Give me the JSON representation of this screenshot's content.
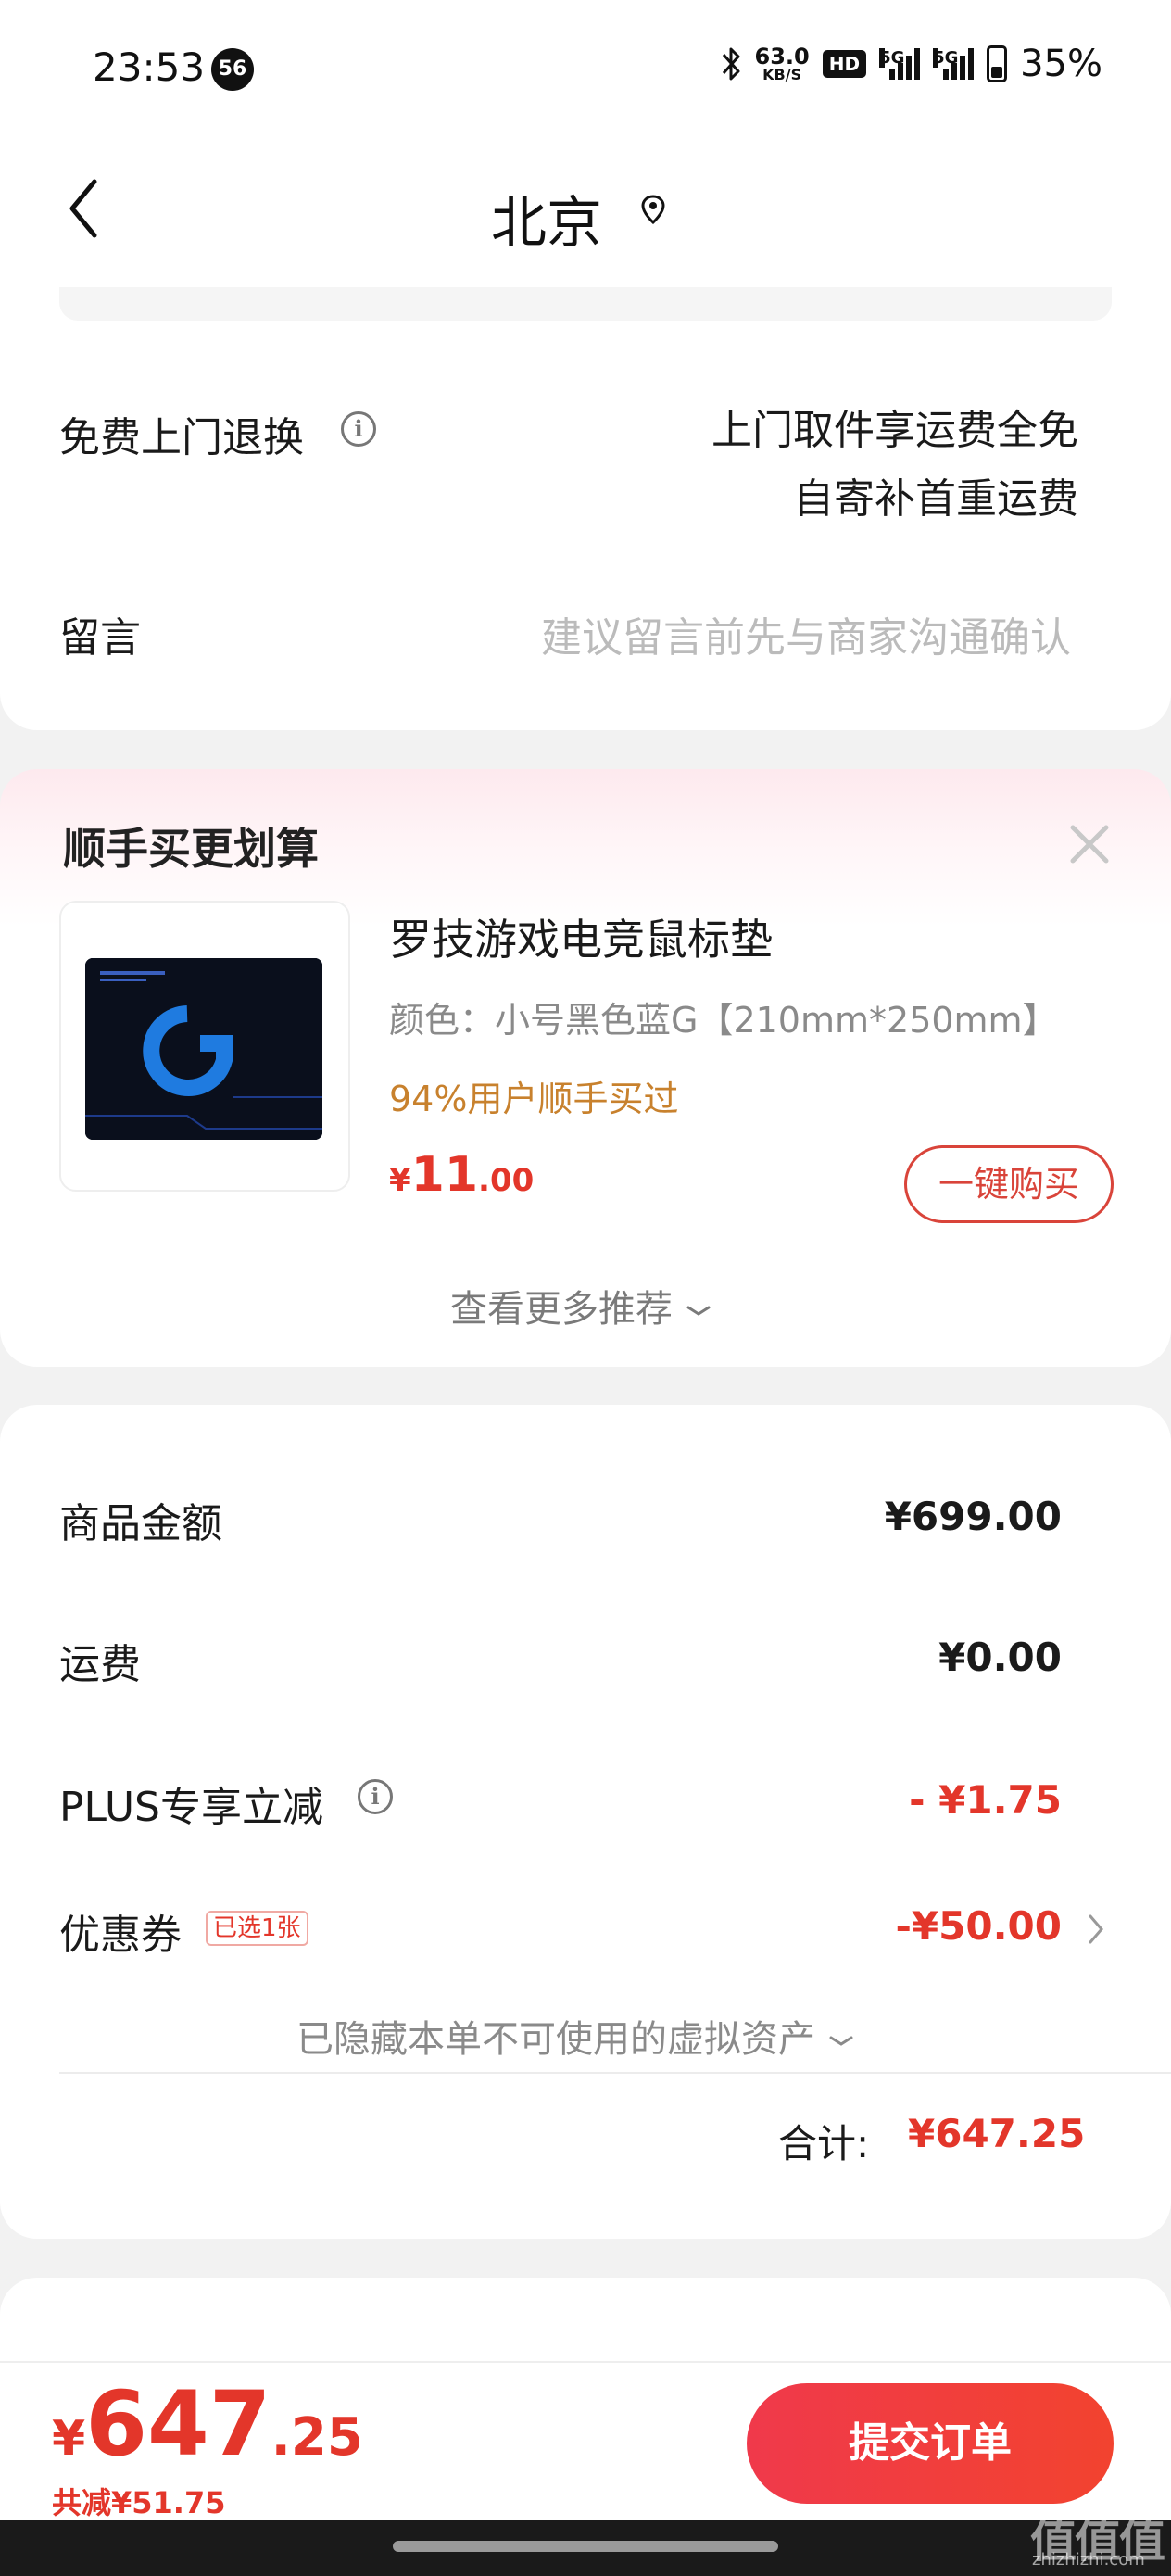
{
  "status_bar": {
    "time": "23:53",
    "notification_count": "56",
    "net_speed_value": "63.0",
    "net_speed_unit": "KB/S",
    "hd_label": "HD",
    "signal1_label": "5G",
    "signal2_label": "5G",
    "battery": "35%"
  },
  "header": {
    "title": "北京",
    "icons": [
      "back-arrow-icon",
      "location-pin-icon"
    ]
  },
  "shipping": {
    "return_label": "免费上门退换",
    "return_line1": "上门取件享运费全免",
    "return_line2": "自寄补首重运费",
    "message_label": "留言",
    "message_placeholder": "建议留言前先与商家沟通确认"
  },
  "recommend": {
    "title": "顺手买更划算",
    "product_name": "罗技游戏电竞鼠标垫",
    "product_spec": "颜色：小号黑色蓝G【210mm*250mm】",
    "social_proof": "94%用户顺手买过",
    "price_symbol": "¥",
    "price_int": "11",
    "price_dec": ".00",
    "buy_label": "一键购买",
    "more_label": "查看更多推荐",
    "product_image_text": "G"
  },
  "summary": {
    "goods_label": "商品金额",
    "goods_value": "¥699.00",
    "shipping_label": "运费",
    "shipping_value": "¥0.00",
    "plus_label": "PLUS专享立减",
    "plus_value": "- ¥1.75",
    "coupon_label": "优惠券",
    "coupon_tag": "已选1张",
    "coupon_value": "-¥50.00",
    "hidden_assets": "已隐藏本单不可使用的虚拟资产",
    "total_label": "合计:",
    "total_value": "¥647.25"
  },
  "footer": {
    "price_symbol": "¥",
    "price_int": "647",
    "price_dec": ".25",
    "saved": "共减¥51.75",
    "submit_label": "提交订单"
  },
  "watermark": {
    "text": "值值值",
    "site": "zhizhizhi.com"
  },
  "colors": {
    "accent_red": "#e3362a",
    "social_orange": "#c8812d",
    "background": "#f2f2f2"
  }
}
